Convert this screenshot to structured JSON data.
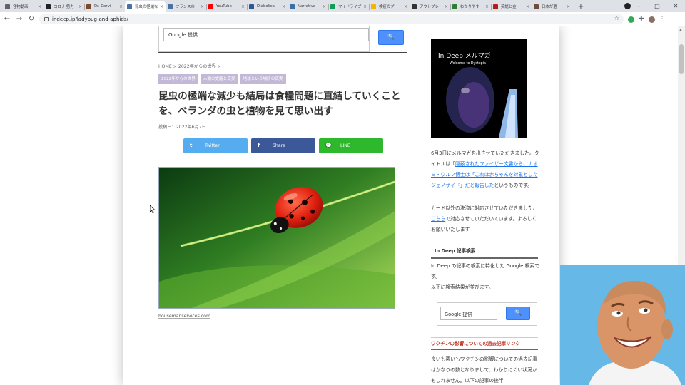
{
  "browser": {
    "tabs": [
      {
        "label": "怪物動画",
        "favicon_color": "#5f6368"
      },
      {
        "label": "コロナ 勢力",
        "favicon_color": "#202124"
      },
      {
        "label": "Dr. Corvi",
        "favicon_color": "#7a4b2a"
      },
      {
        "label": "昆虫の極端な",
        "favicon_color": "#4a6fa5",
        "active": true
      },
      {
        "label": "フランスの",
        "favicon_color": "#4a6fa5"
      },
      {
        "label": "YouTube",
        "favicon_color": "#ff0000"
      },
      {
        "label": "Diabolica",
        "favicon_color": "#2b5797"
      },
      {
        "label": "Narrative",
        "favicon_color": "#3a6ea5"
      },
      {
        "label": "マイドライブ",
        "favicon_color": "#0f9d58"
      },
      {
        "label": "検疫のプ",
        "favicon_color": "#f4b400"
      },
      {
        "label": "アウトブレ",
        "favicon_color": "#333333"
      },
      {
        "label": "わかりやす",
        "favicon_color": "#2e7d32"
      },
      {
        "label": "英語と金",
        "favicon_color": "#b71c1c"
      },
      {
        "label": "日本が選",
        "favicon_color": "#6d4c41"
      }
    ],
    "new_tab_symbol": "+",
    "window_controls": [
      "–",
      "□",
      "✕"
    ],
    "url": "indeep.jp/ladybug-and-aphids/"
  },
  "header": {
    "search_placeholder": "Google 提供",
    "search_button": "🔍"
  },
  "article": {
    "breadcrumb": "HOME > 2022年からの世界 >",
    "categories": [
      "2022年からの世界",
      "人類の覚醒と真実",
      "地球という場所の真実"
    ],
    "title": "昆虫の極端な減少も結局は食糧問題に直結していくことを、ベランダの虫と植物を見て思い出す",
    "date": "投稿日：2022年6月7日",
    "share": {
      "twitter": {
        "icon": "t",
        "label": "Twitter",
        "color": "#55acee"
      },
      "facebook": {
        "icon": "f",
        "label": "Share",
        "color": "#3b5998"
      },
      "line": {
        "icon": "💬",
        "label": "LINE",
        "color": "#2eb82e"
      }
    },
    "image_credit": "housemanservices.com"
  },
  "sidebar": {
    "magazine": {
      "title": "In Deep メルマガ",
      "subtitle": "Welcome to Dystopia"
    },
    "notice1_pre": "6月3日にメルマガを出させていただきました。タイトルは「",
    "notice1_link": "隠蔽されたファイザー文書から、ナオミ・ウルフ博士は「これは赤ちゃんを対象としたジェノサイド」だと報告した",
    "notice1_post": "というものです。",
    "notice2_pre": "カード以外の決済に対応させていただきました。",
    "notice2_link": "こちら",
    "notice2_post": "で対応させていただいています。よろしくお願いいたします",
    "search_heading": "In Deep 記事検索",
    "search_desc_1": "In Deep の記事の検索に特化した Google 検索です。",
    "search_desc_2": "以下に検索結果が並びます。",
    "search_placeholder": "Google 提供",
    "search_button": "🔍",
    "vaccine_heading": "ワクチンの影響についての過去記事リンク",
    "vaccine_text": "良いも悪いもワクチンの影響についての過去記事はかなりの数となりまして、わかりにくい状況かもしれません。以下の記事の後半"
  }
}
